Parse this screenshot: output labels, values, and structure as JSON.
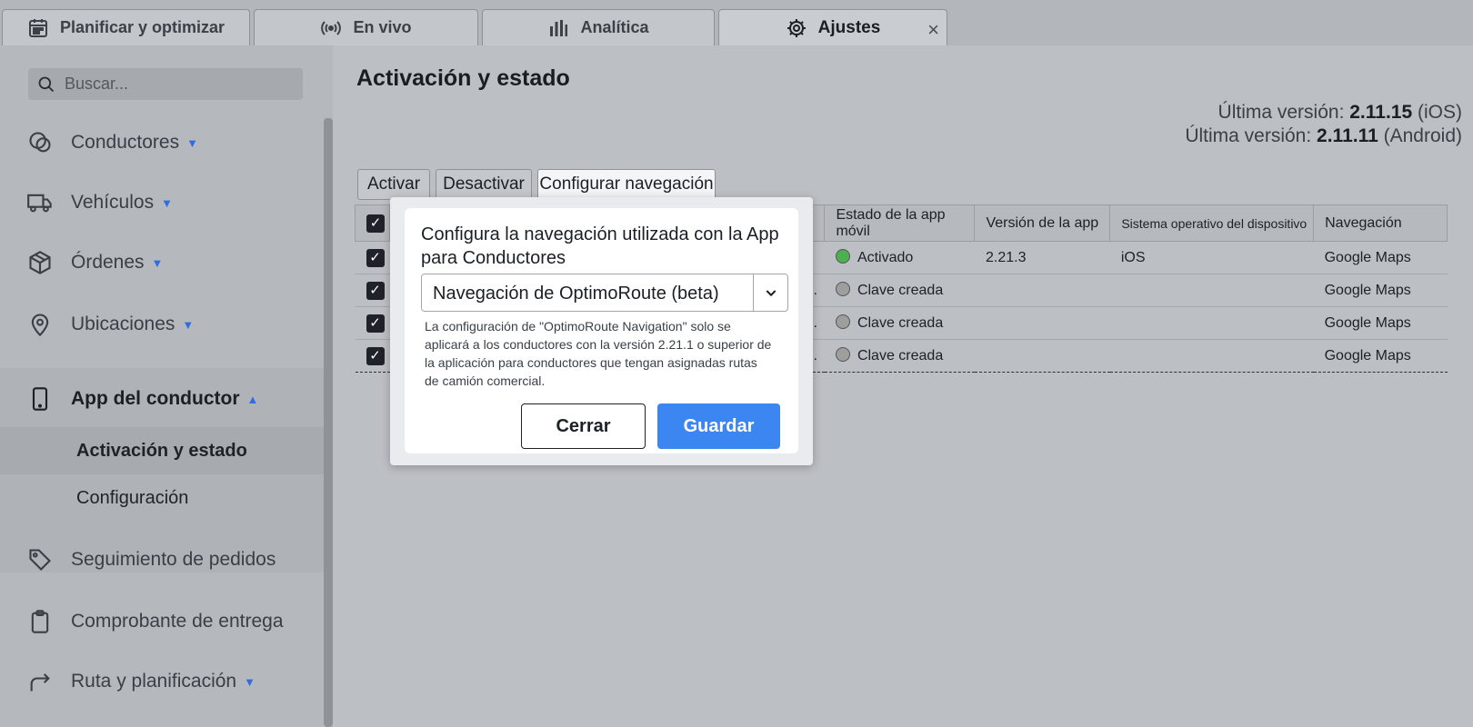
{
  "tabs": [
    {
      "label": "Planificar y optimizar",
      "icon": "calendar-icon"
    },
    {
      "label": "En vivo",
      "icon": "broadcast-icon"
    },
    {
      "label": "Analítica",
      "icon": "bar-chart-icon"
    },
    {
      "label": "Ajustes",
      "icon": "gear-icon",
      "active": true,
      "close": "×"
    }
  ],
  "sidebar": {
    "search_placeholder": "Buscar...",
    "items": [
      {
        "label": "Conductores",
        "icon": "drivers-icon"
      },
      {
        "label": "Vehículos",
        "icon": "truck-icon"
      },
      {
        "label": "Órdenes",
        "icon": "box-icon"
      },
      {
        "label": "Ubicaciones",
        "icon": "location-pin-icon"
      },
      {
        "label": "App del conductor",
        "icon": "phone-icon"
      },
      {
        "label": "Seguimiento de pedidos",
        "icon": "tag-icon"
      },
      {
        "label": "Comprobante de entrega",
        "icon": "clipboard-icon"
      },
      {
        "label": "Ruta y planificación",
        "icon": "route-arrow-icon"
      }
    ],
    "subitems": [
      "Activación y estado",
      "Configuración"
    ]
  },
  "main": {
    "title": "Activación y estado",
    "version_ios_label": "Última versión:",
    "version_ios": "2.11.15",
    "version_ios_os": "(iOS)",
    "version_android_label": "Última versión:",
    "version_android": "2.11.11",
    "version_android_os": "(Android)",
    "actions": [
      "Activar",
      "Desactivar",
      "Configurar navegación"
    ],
    "columns": [
      "Estado de la app móvil",
      "Versión de la app",
      "Sistema operativo del dispositivo",
      "Navegación"
    ],
    "rows": [
      {
        "trunc": "",
        "status": "Activado",
        "status_color": "#4caf50",
        "version": "2.21.3",
        "os": "iOS",
        "nav": "Google Maps"
      },
      {
        "trunc": "...",
        "status": "Clave creada",
        "status_color": "#9e9e9e",
        "version": "",
        "os": "",
        "nav": "Google Maps"
      },
      {
        "trunc": "...",
        "status": "Clave creada",
        "status_color": "#9e9e9e",
        "version": "",
        "os": "",
        "nav": "Google Maps"
      },
      {
        "trunc": "...",
        "status": "Clave creada",
        "status_color": "#9e9e9e",
        "version": "",
        "os": "",
        "nav": "Google Maps"
      }
    ]
  },
  "modal": {
    "title": "Configura la navegación utilizada con la App para Conductores",
    "selected": "Navegación de OptimoRoute (beta)",
    "note": "La configuración de \"OptimoRoute Navigation\" solo se aplicará a los conductores con la versión 2.21.1 o superior de la aplicación para conductores que tengan asignadas rutas de camión comercial.",
    "close_label": "Cerrar",
    "save_label": "Guardar"
  },
  "colors": {
    "accent": "#3b86f0",
    "active_green": "#4caf50",
    "key_gray": "#9e9e9e"
  }
}
